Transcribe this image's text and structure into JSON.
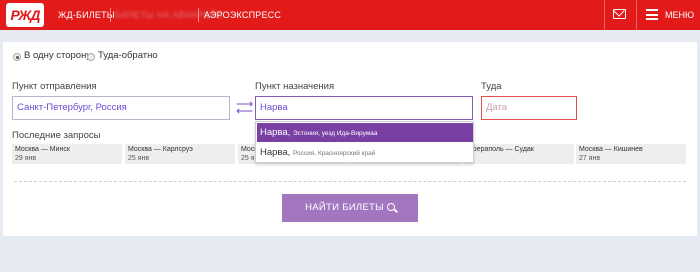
{
  "header": {
    "logo_text": "РЖД",
    "nav": [
      "ЖД-БИЛЕТЫ",
      "БИЛЕТЫ НА АВИАРЕЙС",
      "АЭРОЭКСПРЕСС"
    ],
    "menu_label": "МЕНЮ",
    "brand_color": "#e21a1a"
  },
  "trip_type": {
    "options": [
      "В одну сторону",
      "Туда-обратно"
    ],
    "selected": "В одну сторону"
  },
  "form": {
    "from_label": "Пункт отправления",
    "from_value": "Санкт-Петербург, Россия",
    "to_label": "Пункт назначения",
    "to_value": "Нарва",
    "date_label": "Туда",
    "date_placeholder": "Дата"
  },
  "suggestions": [
    {
      "name": "Нарва,",
      "detail": "Эстония, уезд Ида-Вирумаа"
    },
    {
      "name": "Нарва,",
      "detail": "Россия, Красноярский край"
    }
  ],
  "recent": {
    "title": "Последние запросы",
    "items": [
      {
        "route": "Москва — Минск",
        "date": "29 янв"
      },
      {
        "route": "Москва — Карлсруэ",
        "date": "25 янв"
      },
      {
        "route": "Моск",
        "date": "25 я"
      },
      {
        "route": "",
        "date": ""
      },
      {
        "route": "ифераполь — Судак",
        "date": ""
      },
      {
        "route": "Москва — Кишинев",
        "date": "27 янв"
      }
    ]
  },
  "search_button": "НАЙТИ БИЛЕТЫ",
  "icons": {
    "mail": "mail-icon",
    "menu": "menu-icon",
    "search": "search-icon",
    "swap": "swap-arrows-icon"
  },
  "accent_color": "#a277c0"
}
